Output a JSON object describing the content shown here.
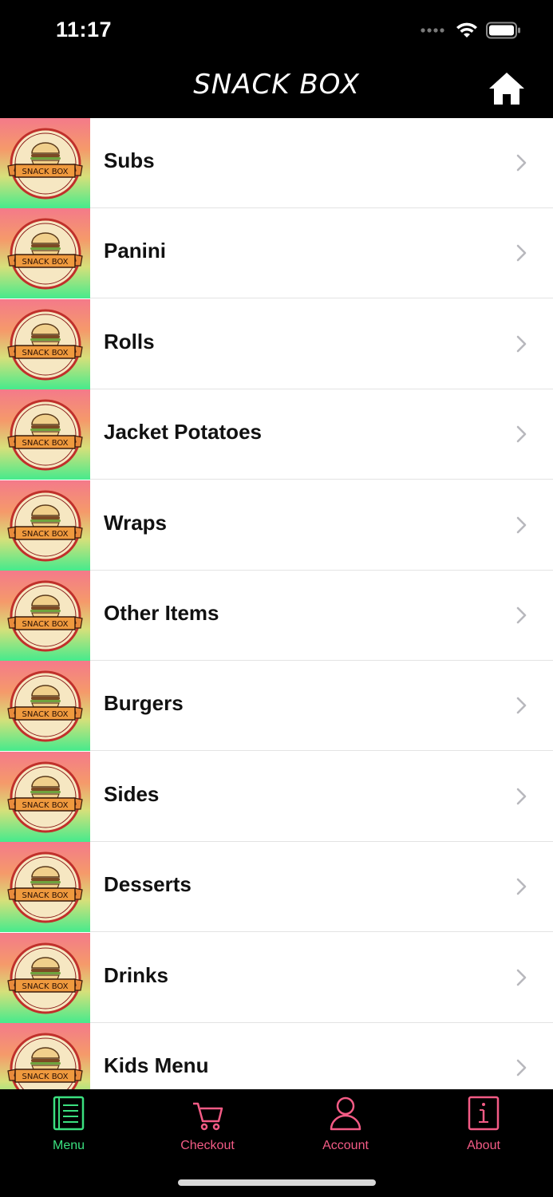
{
  "status_bar": {
    "time": "11:17"
  },
  "nav": {
    "title": "SNACK BOX"
  },
  "menu": {
    "thumbnail_logo_text": "SNACK BOX",
    "items": [
      {
        "label": "Subs"
      },
      {
        "label": "Panini"
      },
      {
        "label": "Rolls"
      },
      {
        "label": "Jacket Potatoes"
      },
      {
        "label": "Wraps"
      },
      {
        "label": "Other Items"
      },
      {
        "label": "Burgers"
      },
      {
        "label": "Sides"
      },
      {
        "label": "Desserts"
      },
      {
        "label": "Drinks"
      },
      {
        "label": "Kids Menu"
      }
    ]
  },
  "tab_bar": {
    "tabs": [
      {
        "label": "Menu",
        "icon": "menu-book-icon",
        "active": true
      },
      {
        "label": "Checkout",
        "icon": "cart-icon",
        "active": false
      },
      {
        "label": "Account",
        "icon": "user-icon",
        "active": false
      },
      {
        "label": "About",
        "icon": "info-icon",
        "active": false
      }
    ]
  },
  "colors": {
    "active_tab": "#3be07f",
    "inactive_tab": "#f35b85",
    "header_bg": "#000000"
  }
}
